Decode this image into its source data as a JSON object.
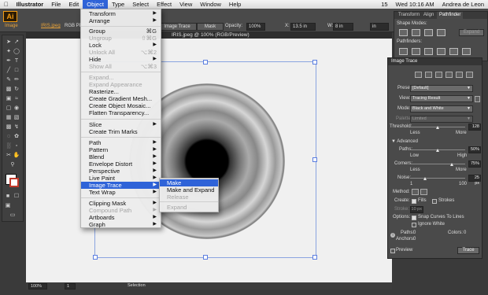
{
  "menubar": {
    "apple_icon": "apple-icon",
    "items": [
      "Illustrator",
      "File",
      "Edit",
      "Object",
      "Type",
      "Select",
      "Effect",
      "View",
      "Window",
      "Help"
    ],
    "right": {
      "battery": "15",
      "datetime": "Wed 10:16 AM",
      "user": "Andrea de Leon"
    }
  },
  "control_bar": {
    "image_label": "Image",
    "doc_name": "IRIS.jpeg",
    "ppi": "RGB PPI: 72",
    "trace_preset": "Image Trace",
    "mask_label": "Mask",
    "opacity_label": "Opacity:",
    "opacity_value": "100%",
    "x_label": "X:",
    "x_value": "13.5 in",
    "w_label": "W:",
    "w_value": "8 in",
    "h_value": "in"
  },
  "app_logo": "Ai",
  "document": {
    "tab_title": "IRIS.jpeg @ 100% (RGB/Preview)"
  },
  "status": {
    "zoom": "100%",
    "page": "1",
    "mode": "Selection"
  },
  "object_menu": {
    "items": [
      {
        "label": "Transform",
        "sub": true
      },
      {
        "label": "Arrange",
        "sub": true
      },
      {
        "label": "Group",
        "shortcut": "⌘G"
      },
      {
        "label": "Ungroup",
        "shortcut": "⇧⌘G",
        "disabled": true
      },
      {
        "label": "Lock",
        "sub": true
      },
      {
        "label": "Unlock All",
        "shortcut": "⌥⌘2",
        "disabled": true
      },
      {
        "label": "Hide",
        "sub": true
      },
      {
        "label": "Show All",
        "shortcut": "⌥⌘3",
        "disabled": true
      },
      {
        "label": "Expand...",
        "disabled": true
      },
      {
        "label": "Expand Appearance",
        "disabled": true
      },
      {
        "label": "Rasterize..."
      },
      {
        "label": "Create Gradient Mesh..."
      },
      {
        "label": "Create Object Mosaic..."
      },
      {
        "label": "Flatten Transparency..."
      },
      {
        "label": "Slice",
        "sub": true
      },
      {
        "label": "Create Trim Marks"
      },
      {
        "label": "Path",
        "sub": true
      },
      {
        "label": "Pattern",
        "sub": true
      },
      {
        "label": "Blend",
        "sub": true
      },
      {
        "label": "Envelope Distort",
        "sub": true
      },
      {
        "label": "Perspective",
        "sub": true
      },
      {
        "label": "Live Paint",
        "sub": true
      },
      {
        "label": "Image Trace",
        "sub": true,
        "highlighted": true
      },
      {
        "label": "Text Wrap",
        "sub": true
      },
      {
        "label": "Clipping Mask",
        "sub": true
      },
      {
        "label": "Compound Path",
        "sub": true,
        "disabled": true
      },
      {
        "label": "Artboards",
        "sub": true
      },
      {
        "label": "Graph",
        "sub": true
      }
    ]
  },
  "image_trace_submenu": {
    "items": [
      {
        "label": "Make",
        "highlighted": true
      },
      {
        "label": "Make and Expand"
      },
      {
        "label": "Release",
        "disabled": true
      },
      {
        "label": "Expand",
        "disabled": true
      }
    ]
  },
  "pathfinder_panel": {
    "tabs": [
      "Transform",
      "Align",
      "Pathfinder"
    ],
    "shape_modes": "Shape Modes:",
    "expand": "Expand",
    "pathfinders": "Pathfinders:"
  },
  "image_trace_panel": {
    "title": "Image Trace",
    "preset_label": "Preset:",
    "preset_value": "[Default]",
    "view_label": "View:",
    "view_value": "Tracing Result",
    "mode_label": "Mode:",
    "mode_value": "Black and White",
    "palette_label": "Palette:",
    "palette_value": "Limited",
    "threshold_label": "Threshold:",
    "threshold_value": "128",
    "less": "Less",
    "more": "More",
    "advanced": "Advanced",
    "paths_label": "Paths:",
    "paths_value": "50%",
    "low": "Low",
    "high": "High",
    "corners_label": "Corners:",
    "corners_value": "75%",
    "noise_label": "Noise:",
    "noise_value": "25 px",
    "noise_min": "1",
    "noise_max": "100",
    "method_label": "Method:",
    "create_label": "Create:",
    "fills": "Fills",
    "strokes": "Strokes",
    "stroke_label": "Stroke:",
    "stroke_value": "10 px",
    "options_label": "Options:",
    "snap": "Snap Curves To Lines",
    "ignore_white": "Ignore White",
    "paths_count_label": "Paths:",
    "paths_count": "0",
    "colors_label": "Colors:",
    "colors_count": "0",
    "anchors_label": "Anchors:",
    "anchors_count": "0",
    "preview": "Preview",
    "trace_button": "Trace"
  }
}
